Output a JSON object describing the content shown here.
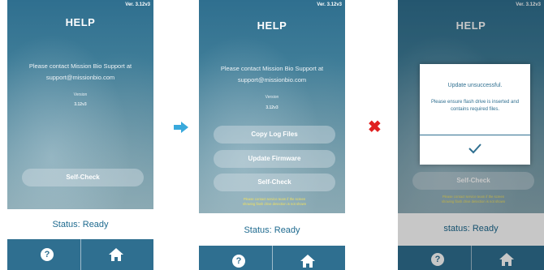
{
  "screens": [
    {
      "version": "Ver. 3.12v3",
      "title": "HELP",
      "contact_line1": "Please contact Mission Bio Support at",
      "contact_line2": "support@missionbio.com",
      "version_label": "Version",
      "version_value": "3.12v3",
      "buttons": [
        "Self-Check"
      ],
      "status": "Status: Ready"
    },
    {
      "version": "Ver. 3.12v3",
      "title": "HELP",
      "contact_line1": "Please contact Mission Bio Support at",
      "contact_line2": "support@missionbio.com",
      "version_label": "Version",
      "version_value": "3.12v3",
      "buttons": [
        "Copy Log Files",
        "Update Firmware",
        "Self-Check"
      ],
      "note_line1": "Please contact service team if the screen",
      "note_line2": "showing flash drive detection is not shown",
      "status": "Status: Ready"
    },
    {
      "version": "Ver. 3.12v3",
      "title": "HELP",
      "buttons": [
        "Self-Check"
      ],
      "note_line1": "Please contact service team if the screen",
      "note_line2": "showing flash drive detection is not shown",
      "status": "status: Ready",
      "dialog": {
        "title": "Update unsuccessful.",
        "message": "Please ensure flash drive is inserted and contains required files."
      }
    }
  ],
  "icons": {
    "help": "help-icon",
    "home": "home-icon",
    "check": "check-icon",
    "arrow": "arrow-right-icon",
    "x": "x-mark-icon"
  },
  "colors": {
    "accent": "#2f6f90",
    "status_text": "#1e6a8f",
    "arrow": "#39a9dc",
    "x_mark": "#e02020",
    "note_text": "#f0e060"
  }
}
